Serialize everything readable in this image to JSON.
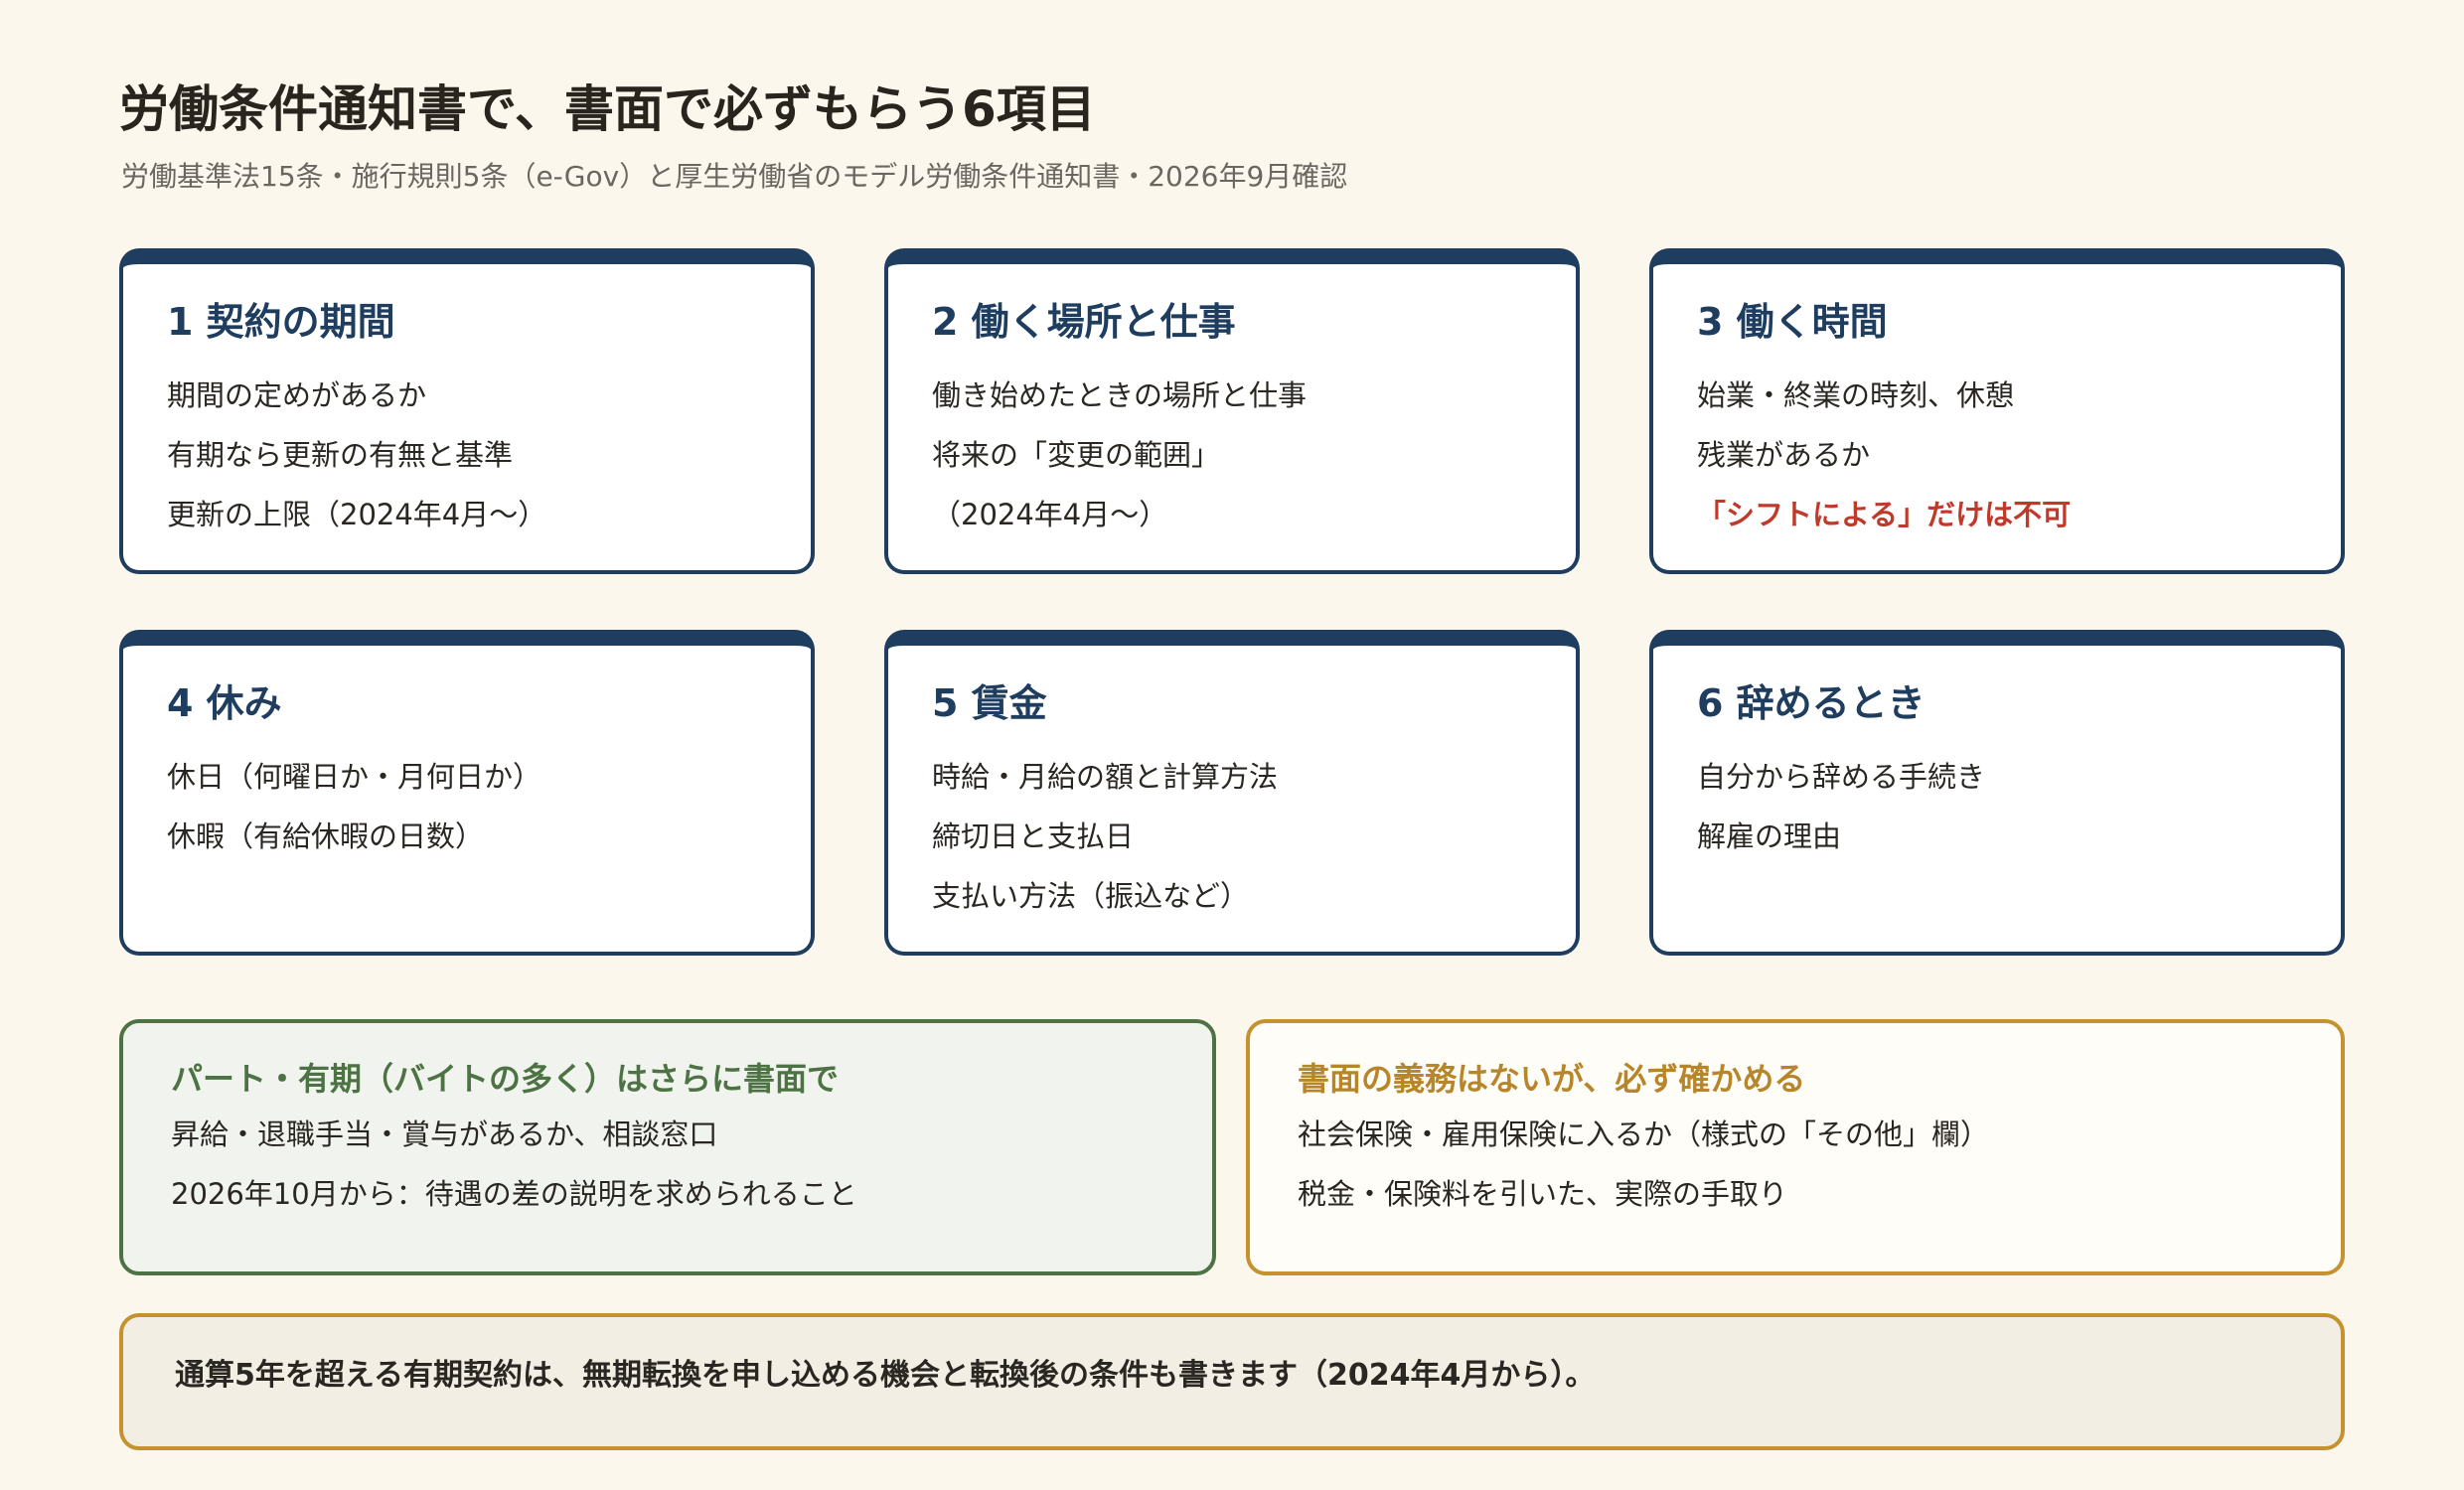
{
  "header": {
    "title": "労働条件通知書で、書面で必ずもらう6項目",
    "subtitle": "労働基準法15条・施行規則5条（e-Gov）と厚生労働省のモデル労働条件通知書・2026年9月確認"
  },
  "cards": [
    {
      "title": "1 契約の期間",
      "lines": [
        "期間の定めがあるか",
        "有期なら更新の有無と基準",
        "更新の上限（2024年4月〜）"
      ]
    },
    {
      "title": "2 働く場所と仕事",
      "lines": [
        "働き始めたときの場所と仕事",
        "将来の「変更の範囲」",
        "（2024年4月〜）"
      ]
    },
    {
      "title": "3 働く時間",
      "lines": [
        "始業・終業の時刻、休憩",
        "残業があるか",
        "「シフトによる」だけは不可"
      ]
    },
    {
      "title": "4 休み",
      "lines": [
        "休日（何曜日か・月何日か）",
        "休暇（有給休暇の日数）"
      ]
    },
    {
      "title": "5 賃金",
      "lines": [
        "時給・月給の額と計算方法",
        "締切日と支払日",
        "支払い方法（振込など）"
      ]
    },
    {
      "title": "6 辞めるとき",
      "lines": [
        "自分から辞める手続き",
        "解雇の理由"
      ]
    }
  ],
  "notes": {
    "part_time": {
      "title": "パート・有期（バイトの多く）はさらに書面で",
      "lines": [
        "昇給・退職手当・賞与があるか、相談窓口",
        "2026年10月から：待遇の差の説明を求められること"
      ]
    },
    "check": {
      "title": "書面の義務はないが、必ず確かめる",
      "lines": [
        "社会保険・雇用保険に入るか（様式の「その他」欄）",
        "税金・保険料を引いた、実際の手取り"
      ]
    }
  },
  "footer": {
    "text": "通算5年を超える有期契約は、無期転換を申し込める機会と転換後の条件も書きます（2024年4月から）。"
  },
  "colors": {
    "background": "#fbf7ec",
    "card_border": "#1e3d5f",
    "warning_text": "#c03a2b",
    "green_accent": "#4d7244",
    "gold_accent": "#c4922e"
  }
}
